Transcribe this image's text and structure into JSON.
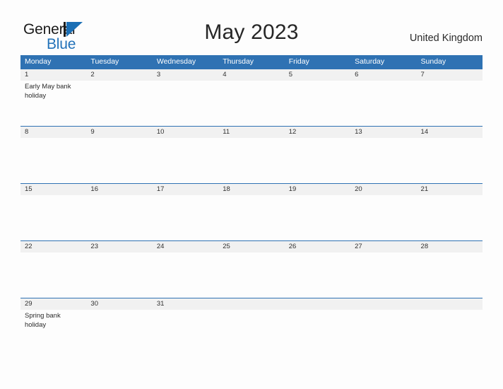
{
  "brand": {
    "name_part1": "General",
    "name_part2": "Blue",
    "logo_icon": "triangle-flag-icon"
  },
  "header": {
    "title": "May 2023",
    "country": "United Kingdom"
  },
  "colors": {
    "header_blue": "#2f72b3",
    "brand_blue": "#2372b9",
    "date_band_gray": "#f1f1f1",
    "page_background": "#fdfdfd",
    "text_dark": "#262626"
  },
  "calendar": {
    "weekdays": [
      "Monday",
      "Tuesday",
      "Wednesday",
      "Thursday",
      "Friday",
      "Saturday",
      "Sunday"
    ],
    "weeks": [
      {
        "days": [
          {
            "date": "1",
            "event": "Early May bank holiday"
          },
          {
            "date": "2",
            "event": ""
          },
          {
            "date": "3",
            "event": ""
          },
          {
            "date": "4",
            "event": ""
          },
          {
            "date": "5",
            "event": ""
          },
          {
            "date": "6",
            "event": ""
          },
          {
            "date": "7",
            "event": ""
          }
        ]
      },
      {
        "days": [
          {
            "date": "8",
            "event": ""
          },
          {
            "date": "9",
            "event": ""
          },
          {
            "date": "10",
            "event": ""
          },
          {
            "date": "11",
            "event": ""
          },
          {
            "date": "12",
            "event": ""
          },
          {
            "date": "13",
            "event": ""
          },
          {
            "date": "14",
            "event": ""
          }
        ]
      },
      {
        "days": [
          {
            "date": "15",
            "event": ""
          },
          {
            "date": "16",
            "event": ""
          },
          {
            "date": "17",
            "event": ""
          },
          {
            "date": "18",
            "event": ""
          },
          {
            "date": "19",
            "event": ""
          },
          {
            "date": "20",
            "event": ""
          },
          {
            "date": "21",
            "event": ""
          }
        ]
      },
      {
        "days": [
          {
            "date": "22",
            "event": ""
          },
          {
            "date": "23",
            "event": ""
          },
          {
            "date": "24",
            "event": ""
          },
          {
            "date": "25",
            "event": ""
          },
          {
            "date": "26",
            "event": ""
          },
          {
            "date": "27",
            "event": ""
          },
          {
            "date": "28",
            "event": ""
          }
        ]
      },
      {
        "days": [
          {
            "date": "29",
            "event": "Spring bank holiday"
          },
          {
            "date": "30",
            "event": ""
          },
          {
            "date": "31",
            "event": ""
          },
          {
            "date": "",
            "event": ""
          },
          {
            "date": "",
            "event": ""
          },
          {
            "date": "",
            "event": ""
          },
          {
            "date": "",
            "event": ""
          }
        ]
      }
    ]
  }
}
